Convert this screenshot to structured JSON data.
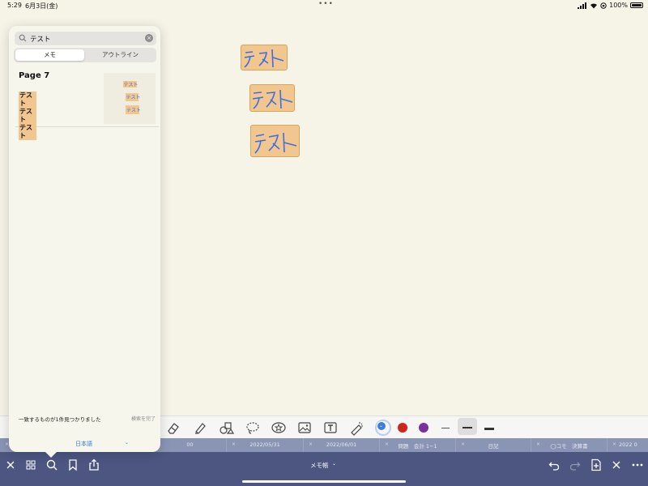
{
  "status_bar": {
    "time": "5:29",
    "date": "6月3日(金)",
    "dots": "•••",
    "battery_percent": "100%",
    "battery_level": 1.0
  },
  "canvas": {
    "ink_words": [
      "テスト",
      "テスト",
      "テスト"
    ],
    "ink_color": "#3f6fe0",
    "highlight_color": "#f1c68f"
  },
  "search_panel": {
    "query": "テスト",
    "segments": {
      "memo": "メモ",
      "outline": "アウトライン"
    },
    "result": {
      "page_label": "Page 7",
      "hits": [
        "テスト",
        "テスト",
        "テスト"
      ],
      "thumb_words": [
        "テスト",
        "テスト",
        "テスト"
      ]
    },
    "status_text": "一致するものが1件見つかりました",
    "done_label": "検索を完了",
    "language": "日本語"
  },
  "pen_toolbar": {
    "colors": [
      "#3b7de0",
      "#d0261b",
      "#7b2fa0"
    ],
    "selected_color": "#3b7de0"
  },
  "tabs": [
    {
      "label": "00"
    },
    {
      "label": "2022/05/31"
    },
    {
      "label": "2022/06/01"
    },
    {
      "label": "問題　会計 1−1"
    },
    {
      "label": "日記"
    },
    {
      "label": "◯コモ　決算書"
    },
    {
      "label": "2022 0"
    }
  ],
  "bottom_bar": {
    "notebook_title": "メモ帳"
  }
}
